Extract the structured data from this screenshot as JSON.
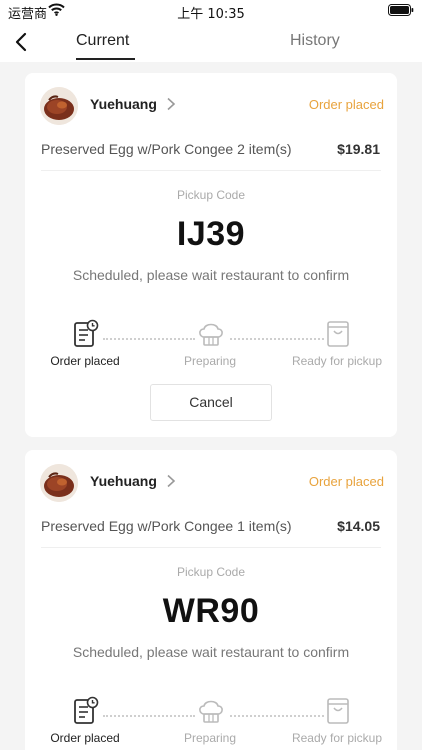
{
  "status_bar": {
    "carrier": "运营商",
    "time": "上午 10:35"
  },
  "nav": {
    "tabs": [
      {
        "label": "Current",
        "active": true
      },
      {
        "label": "History",
        "active": false
      }
    ]
  },
  "orders": [
    {
      "shop_name": "Yuehuang",
      "status": "Order placed",
      "item": "Preserved Egg w/Pork Congee 2 item(s)",
      "price": "$19.81",
      "pickup_label": "Pickup Code",
      "pickup_code": "IJ39",
      "message": "Scheduled, please wait restaurant to confirm",
      "steps": [
        "Order placed",
        "Preparing",
        "Ready for pickup"
      ],
      "active_step": 0,
      "cancel_label": "Cancel"
    },
    {
      "shop_name": "Yuehuang",
      "status": "Order placed",
      "item": "Preserved Egg w/Pork Congee 1 item(s)",
      "price": "$14.05",
      "pickup_label": "Pickup Code",
      "pickup_code": "WR90",
      "message": "Scheduled, please wait restaurant to confirm",
      "steps": [
        "Order placed",
        "Preparing",
        "Ready for pickup"
      ],
      "active_step": 0
    }
  ],
  "icons": {
    "back": "chevron-left-icon",
    "shop_link": "chevron-right-icon",
    "step_icons": [
      "order-placed-icon",
      "chef-hat-icon",
      "pickup-bag-icon"
    ]
  },
  "colors": {
    "status_accent": "#e8a33d",
    "active_text": "#222222",
    "inactive_text": "#aaaaaa"
  }
}
